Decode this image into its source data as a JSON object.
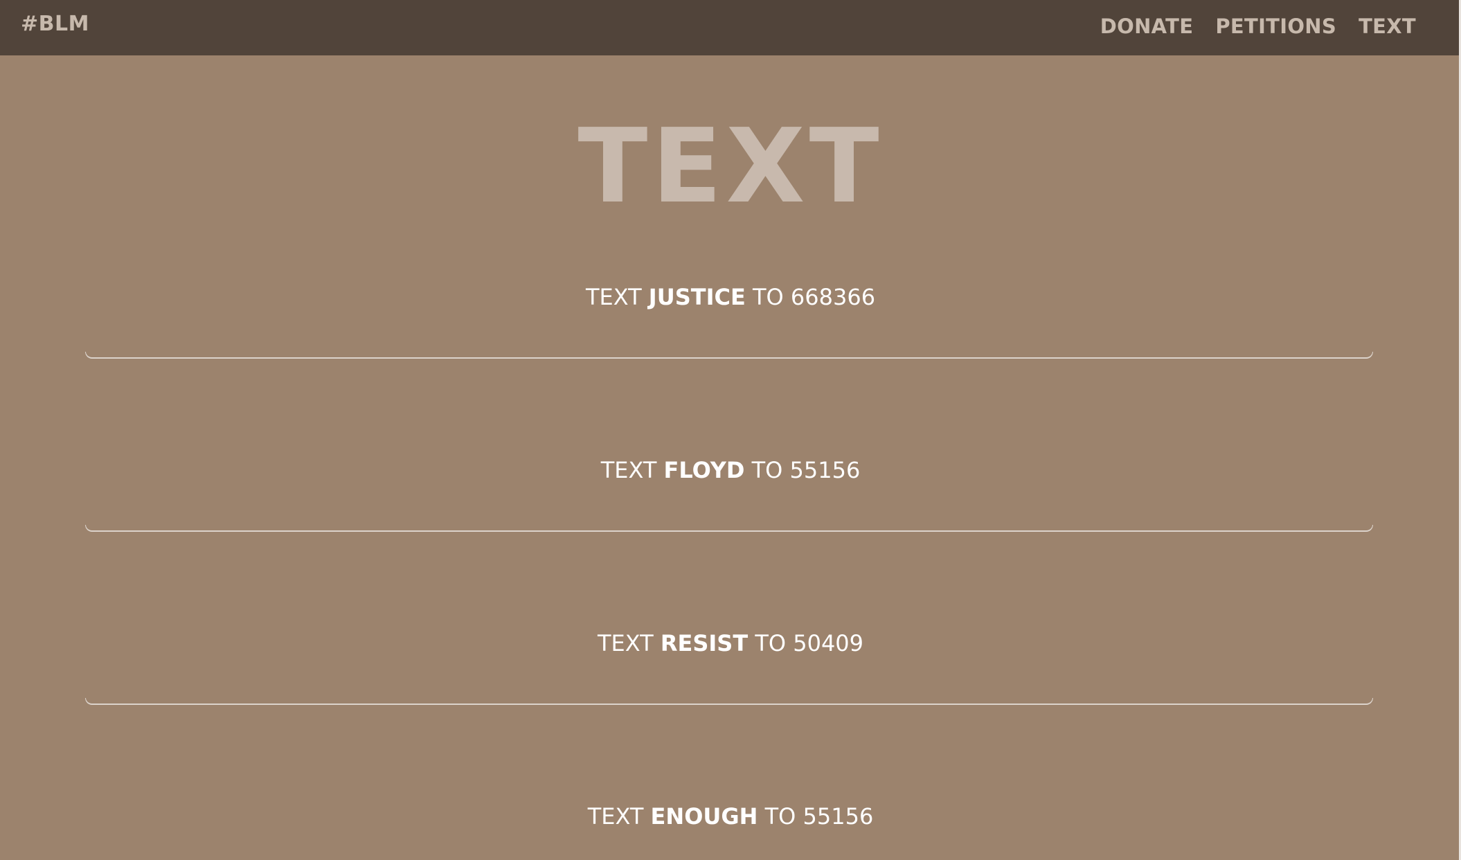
{
  "nav": {
    "brand": "#BLM",
    "links": [
      "DONATE",
      "PETITIONS",
      "TEXT"
    ]
  },
  "page_title": "TEXT",
  "entries": [
    {
      "prefix": "TEXT ",
      "keyword": "JUSTICE",
      "suffix": " TO 668366"
    },
    {
      "prefix": "TEXT ",
      "keyword": "FLOYD",
      "suffix": " TO 55156"
    },
    {
      "prefix": "TEXT ",
      "keyword": "RESIST",
      "suffix": " TO 50409"
    },
    {
      "prefix": "TEXT ",
      "keyword": "ENOUGH",
      "suffix": " TO 55156"
    }
  ],
  "colors": {
    "navbar": "#51443a",
    "background": "#9c836d",
    "title": "#c8b9ad",
    "nav_text": "#c7b9ac",
    "entry_text": "#ffffff",
    "divider": "#dcd3cb"
  }
}
